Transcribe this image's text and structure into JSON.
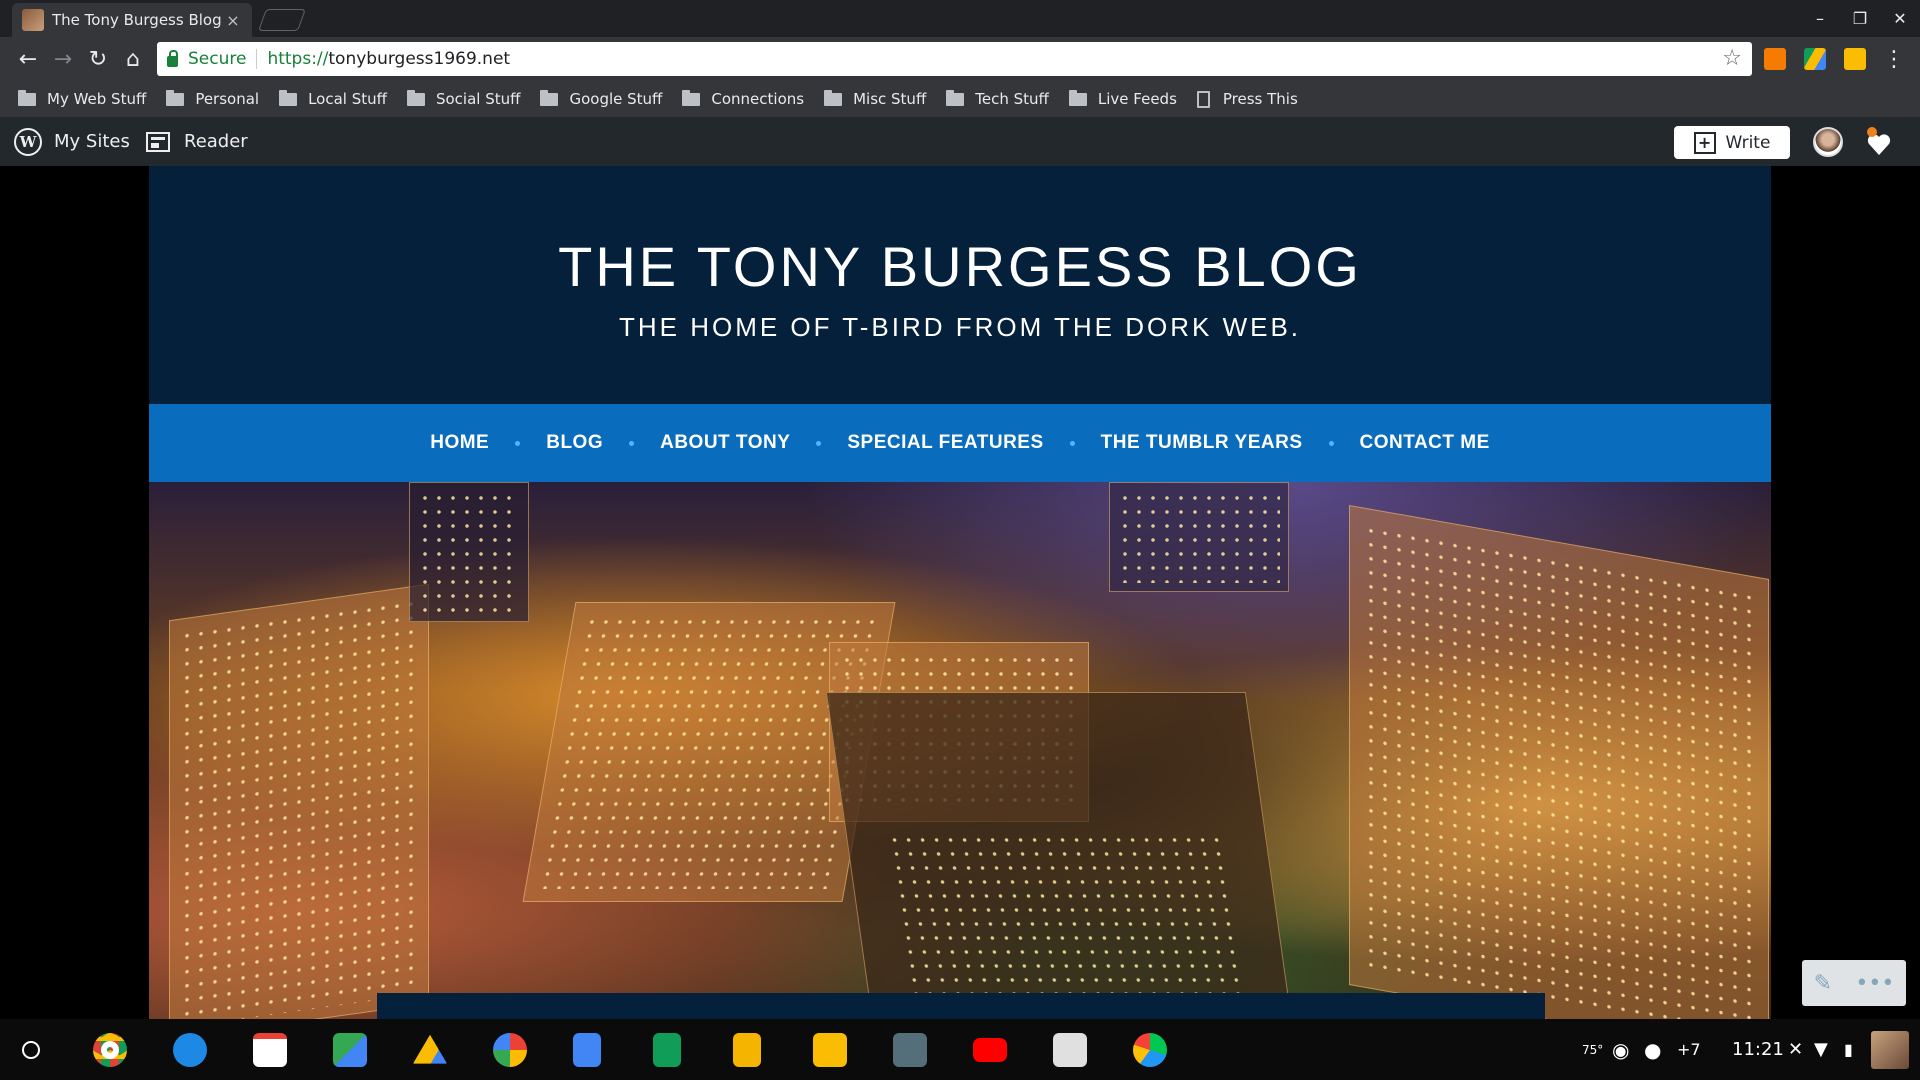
{
  "browser": {
    "tab_title": "The Tony Burgess Blog –",
    "tab_close": "×",
    "secure_label": "Secure",
    "url_scheme": "https://",
    "url_host": "tonyburgess1969.net",
    "window_controls": {
      "minimize": "–",
      "maximize": "❐",
      "close": "✕"
    },
    "nav": {
      "back": "←",
      "forward": "→",
      "reload": "↻",
      "home": "⌂"
    },
    "star": "☆",
    "menu": "⋮"
  },
  "bookmarks": [
    {
      "label": "My Web Stuff",
      "icon": "folder-icon"
    },
    {
      "label": "Personal",
      "icon": "folder-icon"
    },
    {
      "label": "Local Stuff",
      "icon": "folder-icon"
    },
    {
      "label": "Social Stuff",
      "icon": "folder-icon"
    },
    {
      "label": "Google Stuff",
      "icon": "folder-icon"
    },
    {
      "label": "Connections",
      "icon": "folder-icon"
    },
    {
      "label": "Misc Stuff",
      "icon": "folder-icon"
    },
    {
      "label": "Tech Stuff",
      "icon": "folder-icon"
    },
    {
      "label": "Live Feeds",
      "icon": "folder-icon"
    },
    {
      "label": "Press This",
      "icon": "page-icon"
    }
  ],
  "wp_bar": {
    "logo_glyph": "W",
    "my_sites": "My Sites",
    "reader": "Reader",
    "write": "Write",
    "write_glyph": "+"
  },
  "site": {
    "title": "THE TONY BURGESS BLOG",
    "tagline": "THE HOME OF T-BIRD FROM THE DORK WEB.",
    "nav": [
      "HOME",
      "BLOG",
      "ABOUT TONY",
      "SPECIAL FEATURES",
      "THE TUMBLR YEARS",
      "CONTACT ME"
    ]
  },
  "fab": {
    "edit": "✎",
    "more": "•••"
  },
  "shelf": {
    "apps": [
      {
        "name": "chrome-icon",
        "color": "#db4437"
      },
      {
        "name": "files-icon",
        "color": "#1e88e5"
      },
      {
        "name": "gmail-icon",
        "color": "#ea4335"
      },
      {
        "name": "maps-icon",
        "color": "#34a853"
      },
      {
        "name": "drive-icon",
        "color": "#fbbc04"
      },
      {
        "name": "photos-icon",
        "color": "#f4b400"
      },
      {
        "name": "docs-icon",
        "color": "#4285f4"
      },
      {
        "name": "sheets-icon",
        "color": "#0f9d58"
      },
      {
        "name": "slides-icon",
        "color": "#f4b400"
      },
      {
        "name": "keep-icon",
        "color": "#fbbc04"
      },
      {
        "name": "calculator-icon",
        "color": "#546e7a"
      },
      {
        "name": "youtube-icon",
        "color": "#ff0000"
      },
      {
        "name": "calendar-icon",
        "color": "#9e9e9e"
      },
      {
        "name": "play-store-icon",
        "color": "#ffffff"
      }
    ],
    "tray": {
      "temp": "75°",
      "notifications_count": "+7",
      "time": "11:21"
    }
  },
  "colors": {
    "header_bg": "#04203a",
    "nav_bg": "#0a6cbd",
    "nav_dot": "#58b3ff",
    "secure_green": "#188038"
  }
}
